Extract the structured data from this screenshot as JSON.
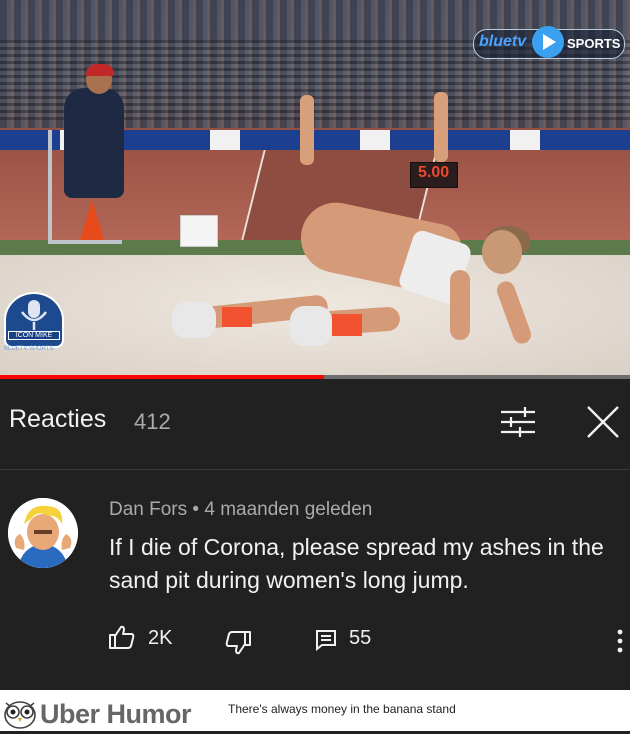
{
  "video": {
    "brand_left": "bluetv",
    "brand_right": "SPORTS",
    "scoreboard": "5.00",
    "overlay_logo": "ICON MIKE",
    "overlay_logo_sub": "BLUETV SPORTS",
    "progress_fraction": 0.515
  },
  "comments_header": {
    "title": "Reacties",
    "count": "412",
    "filter_icon": "sort-filter-icon",
    "close_icon": "close-icon"
  },
  "comment": {
    "author": "Dan Fors",
    "separator": "•",
    "time": "4 maanden geleden",
    "text": "If I die of Corona, please spread my ashes in the sand pit during women's long jump.",
    "likes": "2K",
    "replies": "55",
    "avatar_icon": "cartoon-avatar"
  },
  "footer": {
    "brand": "Uber Humor",
    "tagline": "There's always money in the banana stand"
  },
  "colors": {
    "background": "#212121",
    "text_primary": "#f1f1f1",
    "text_secondary": "#aaaaaa",
    "progress": "#ff0000"
  }
}
